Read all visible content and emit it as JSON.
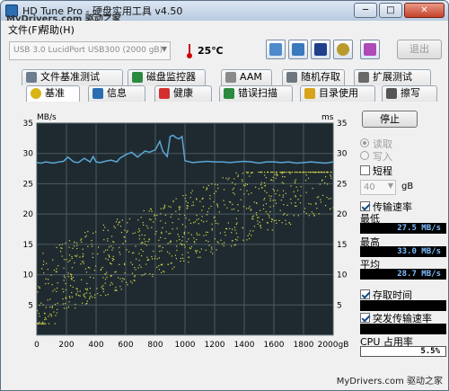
{
  "window": {
    "title": "HD Tune Pro - 硬盘实用工具 v4.50",
    "watermark_top": "MyDrivers.com 驱动之家",
    "watermark_bottom": "MyDrivers.com 驱动之家"
  },
  "menu": [
    "文件(F)",
    "帮助(H)"
  ],
  "toolbar": {
    "drive": "USB 3.0 LucidPort USB300 (2000 gB)",
    "temperature": "25℃",
    "exit_label": "退出"
  },
  "tabs_row1": [
    {
      "label": "文件基准测试",
      "icon": "file-benchmark-icon"
    },
    {
      "label": "磁盘监控器",
      "icon": "disk-monitor-icon"
    },
    {
      "label": "AAM",
      "icon": "speaker-icon"
    },
    {
      "label": "随机存取",
      "icon": "random-access-icon"
    },
    {
      "label": "扩展测试",
      "icon": "extra-tests-icon"
    }
  ],
  "tabs_row2": [
    {
      "label": "基准",
      "icon": "benchmark-icon",
      "active": true
    },
    {
      "label": "信息",
      "icon": "info-icon"
    },
    {
      "label": "健康",
      "icon": "health-icon"
    },
    {
      "label": "错误扫描",
      "icon": "error-scan-icon"
    },
    {
      "label": "目录使用",
      "icon": "folder-usage-icon"
    },
    {
      "label": "擦写",
      "icon": "erase-icon"
    }
  ],
  "controls": {
    "stop_label": "停止",
    "read_label": "读取",
    "write_label": "写入",
    "short_label": "短程",
    "short_value": "40",
    "short_unit": "gB",
    "transfer_label": "传输速率",
    "min_label": "最低",
    "min_value": "27.5 MB/s",
    "max_label": "最高",
    "max_value": "33.0 MB/s",
    "avg_label": "平均",
    "avg_value": "28.7 MB/s",
    "access_label": "存取时间",
    "burst_label": "突发传输速率",
    "cpu_label": "CPU 占用率",
    "cpu_value": "5.5%"
  },
  "colors": {
    "plot_bg": "#1f2a30",
    "grid": "#4b5a60",
    "transfer_line": "#5aa7d6",
    "access_points": "#d9d94a"
  },
  "chart_data": {
    "type": "line",
    "left_axis_label": "MB/s",
    "right_axis_label": "ms",
    "left_ticks": [
      35,
      30,
      25,
      20,
      15,
      10,
      5
    ],
    "right_ticks": [
      35,
      30,
      25,
      20,
      15,
      10,
      5
    ],
    "x_ticks": [
      "0",
      "200",
      "400",
      "600",
      "800",
      "1000",
      "1200",
      "1400",
      "1600",
      "1800",
      "2000gB"
    ],
    "xlim": [
      0,
      2000
    ],
    "ylim": [
      0,
      35
    ],
    "series": [
      {
        "name": "传输速率",
        "x": [
          0,
          30,
          60,
          90,
          110,
          150,
          180,
          210,
          250,
          280,
          320,
          360,
          380,
          400,
          430,
          460,
          500,
          540,
          560,
          600,
          640,
          680,
          700,
          730,
          760,
          800,
          830,
          850,
          880,
          900,
          920,
          940,
          960,
          980,
          1000,
          1050,
          1100,
          1150,
          1200,
          1250,
          1300,
          1350,
          1400,
          1450,
          1500,
          1550,
          1600,
          1650,
          1700,
          1750,
          1800,
          1850,
          1900,
          1950,
          2000
        ],
        "y": [
          28.5,
          28.4,
          28.6,
          28.5,
          28.4,
          28.6,
          28.7,
          29.4,
          28.6,
          28.5,
          29.2,
          28.6,
          29.5,
          28.6,
          28.5,
          28.7,
          28.9,
          28.6,
          29.2,
          29.8,
          30.2,
          29.4,
          29.8,
          30.4,
          30.2,
          30.6,
          32.0,
          30.4,
          29.5,
          32.8,
          33.0,
          32.6,
          32.4,
          32.8,
          28.8,
          28.5,
          28.6,
          28.7,
          28.6,
          28.6,
          28.5,
          28.6,
          28.7,
          28.6,
          28.4,
          28.6,
          28.6,
          28.5,
          28.6,
          28.4,
          28.5,
          28.6,
          28.5,
          28.4,
          28.6
        ]
      },
      {
        "name": "存取时间",
        "points_pattern": "scatter trend from about 7 ms at 0 gB rising to about 24 ms near 2000 gB"
      }
    ]
  }
}
